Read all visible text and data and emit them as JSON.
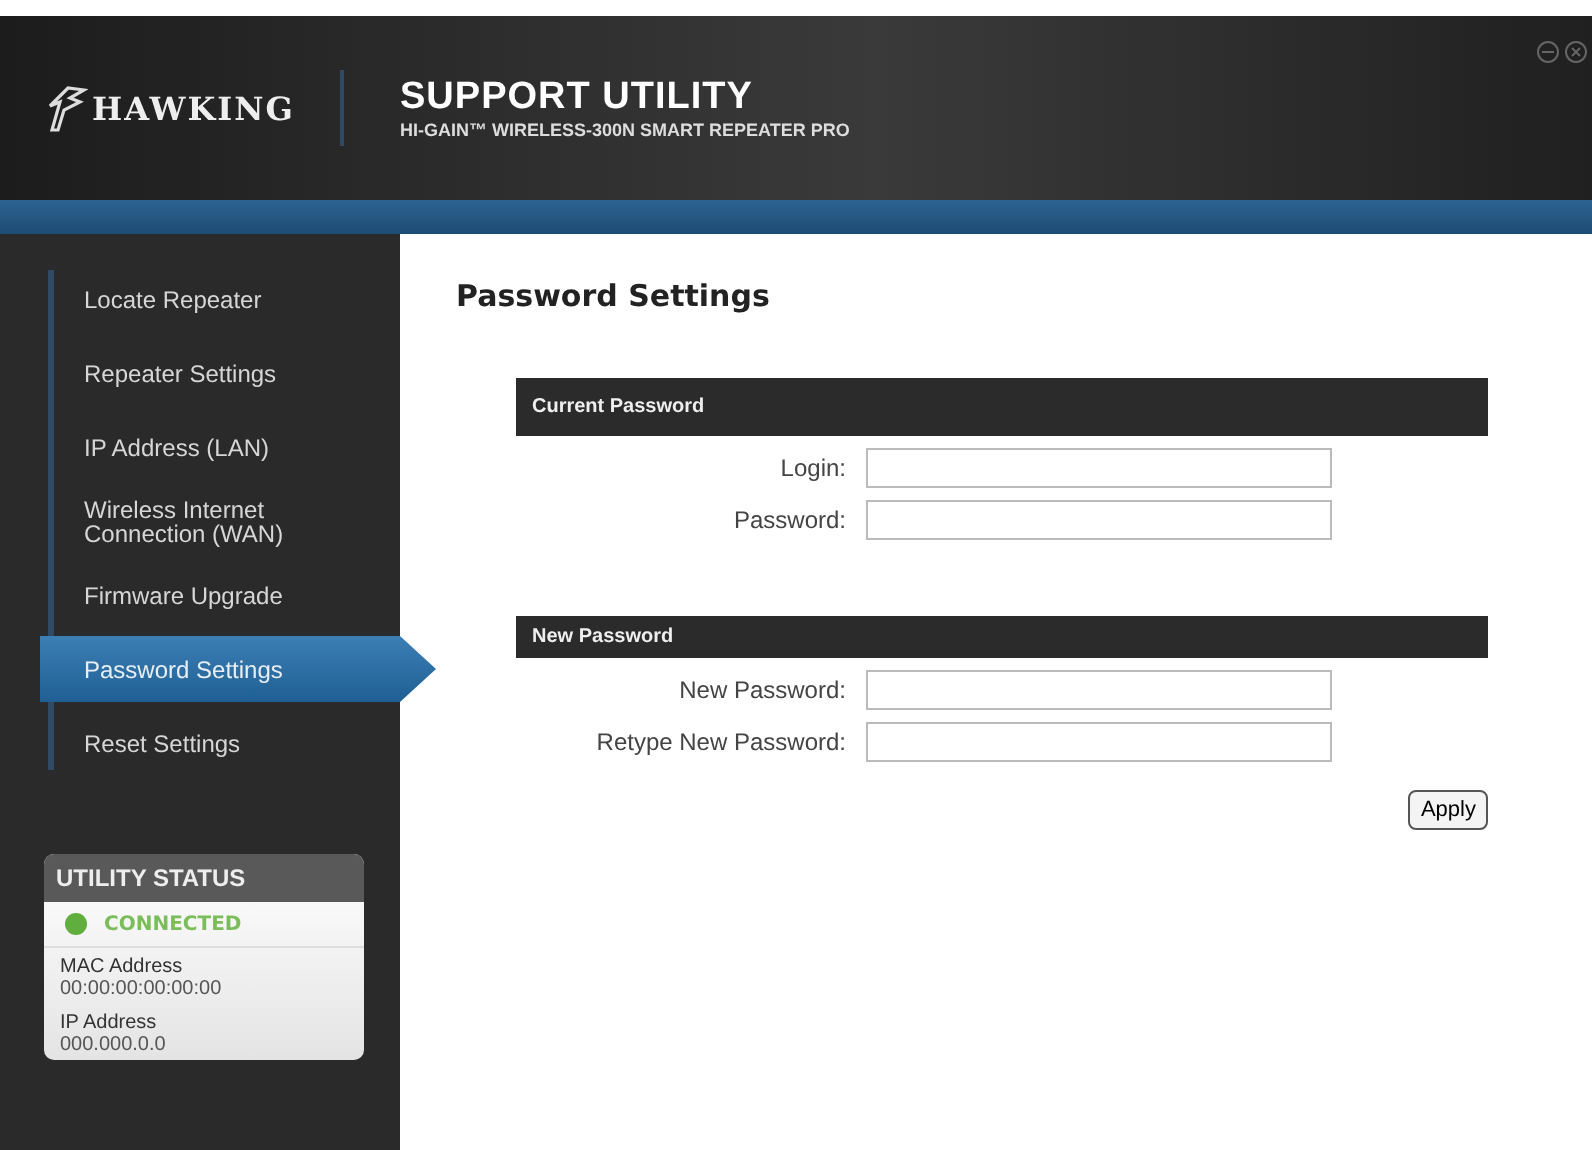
{
  "header": {
    "brand": "HAWKING",
    "title": "SUPPORT UTILITY",
    "subtitle": "HI-GAIN™ WIRELESS-300N SMART REPEATER PRO"
  },
  "sidebar": {
    "items": [
      {
        "label": "Locate Repeater",
        "selected": false
      },
      {
        "label": "Repeater Settings",
        "selected": false
      },
      {
        "label": "IP Address (LAN)",
        "selected": false
      },
      {
        "label": "Wireless Internet Connection (WAN)",
        "selected": false
      },
      {
        "label": "Firmware Upgrade",
        "selected": false
      },
      {
        "label": "Password Settings",
        "selected": true
      },
      {
        "label": "Reset Settings",
        "selected": false
      }
    ]
  },
  "status": {
    "title": "UTILITY STATUS",
    "connection": "CONNECTED",
    "connected": true,
    "entries": [
      {
        "label": "MAC Address",
        "value": "00:00:00:00:00:00"
      },
      {
        "label": "IP Address",
        "value": "000.000.0.0"
      }
    ]
  },
  "page": {
    "title": "Password Settings",
    "sections": [
      {
        "title": "Current Password",
        "fields": [
          {
            "label": "Login:"
          },
          {
            "label": "Password:"
          }
        ]
      },
      {
        "title": "New Password",
        "fields": [
          {
            "label": "New Password:"
          },
          {
            "label": "Retype New Password:"
          }
        ]
      }
    ],
    "button": "Apply"
  }
}
